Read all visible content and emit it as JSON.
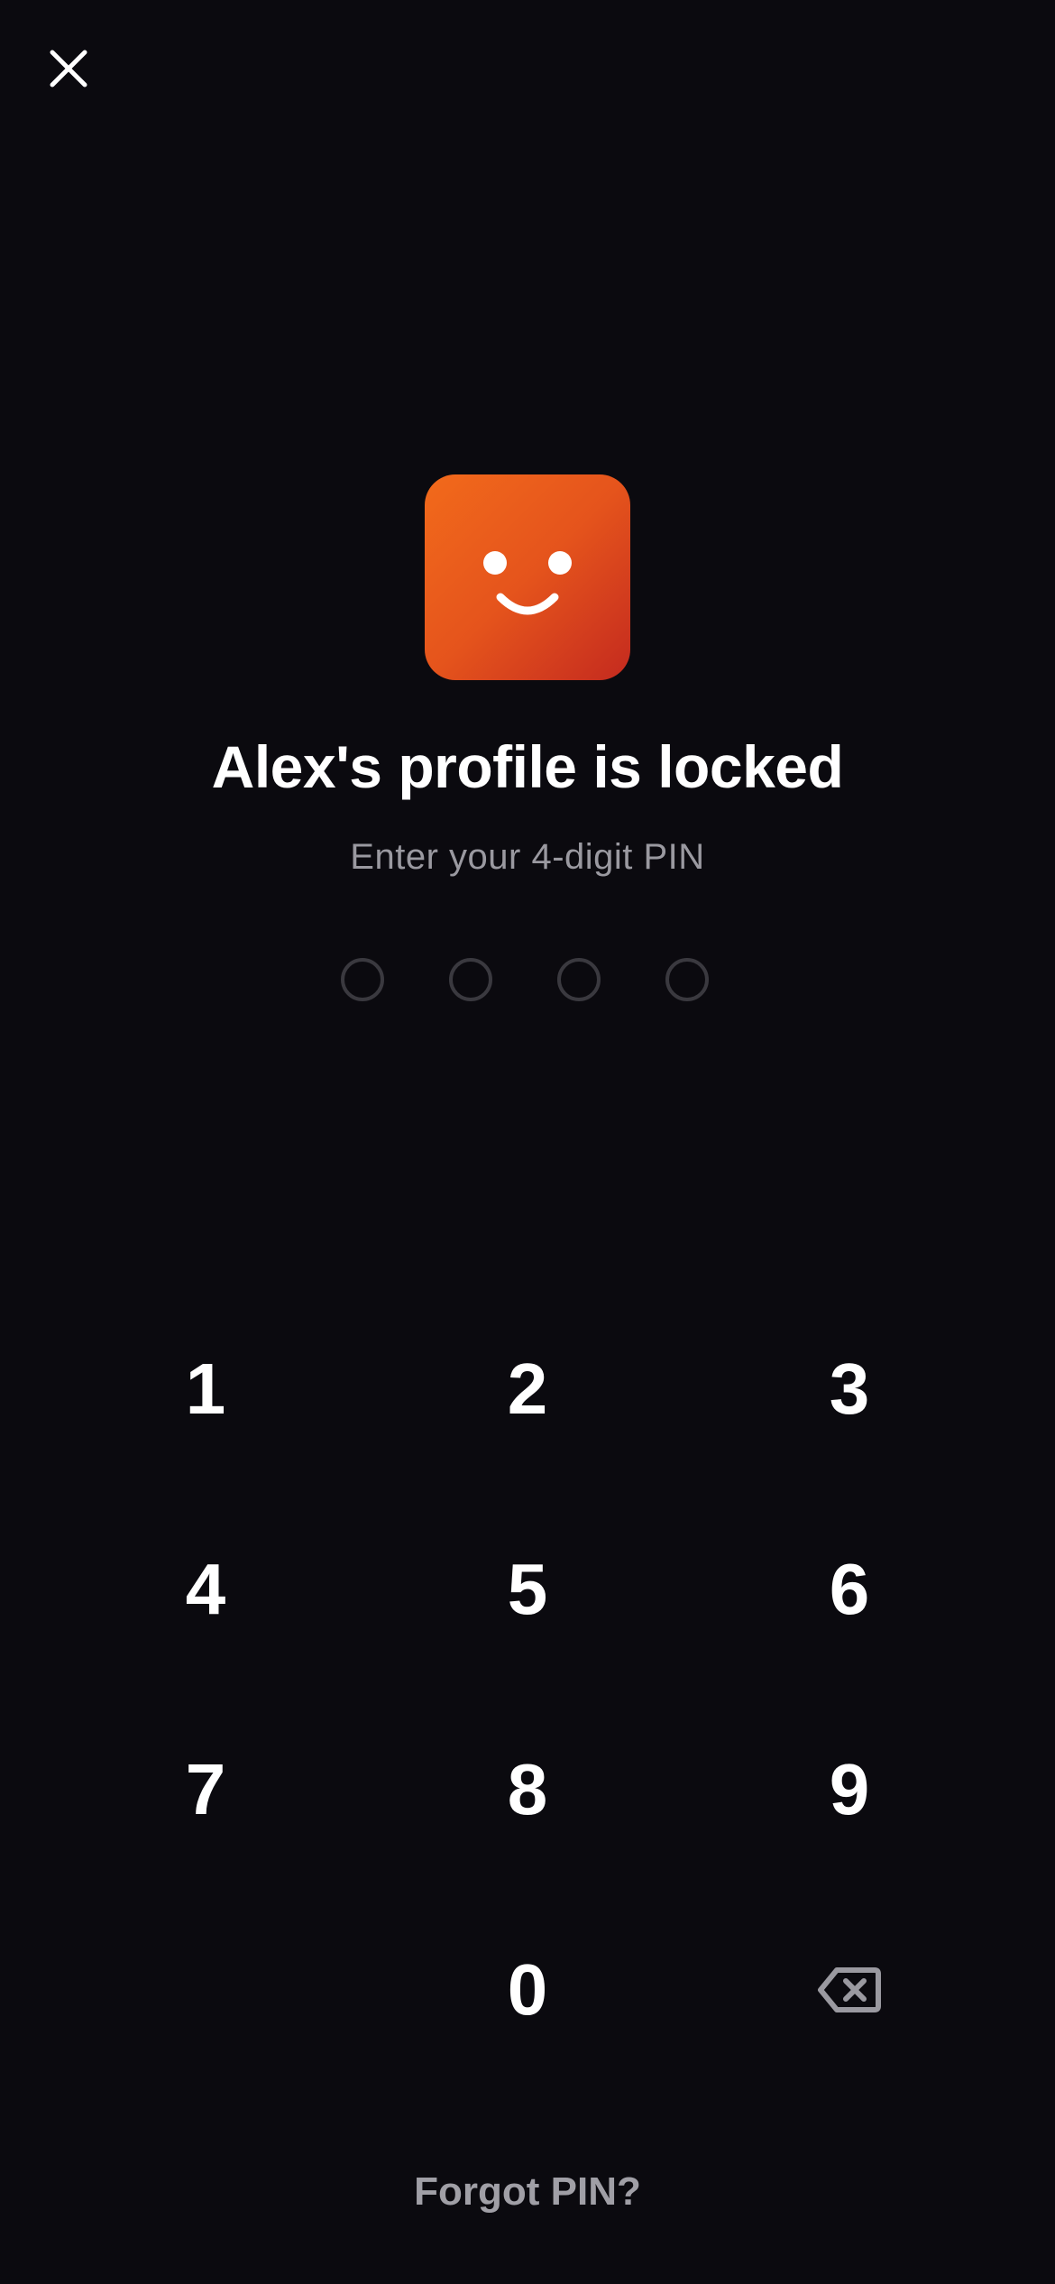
{
  "header": {
    "close_icon": "close-icon"
  },
  "profile": {
    "avatar_icon": "smiley-face-icon",
    "avatar_colors": [
      "#f26a1b",
      "#c42a1f"
    ],
    "title": "Alex's profile is locked",
    "subtitle": "Enter your 4-digit PIN"
  },
  "pin": {
    "length": 4,
    "filled": 0
  },
  "keypad": {
    "keys": [
      "1",
      "2",
      "3",
      "4",
      "5",
      "6",
      "7",
      "8",
      "9",
      "0"
    ],
    "backspace_icon": "backspace-icon"
  },
  "footer": {
    "forgot_label": "Forgot PIN?"
  },
  "colors": {
    "background": "#0b0a0f",
    "text": "#ffffff",
    "muted": "#9a99a0",
    "dot_border": "#3a393f"
  }
}
